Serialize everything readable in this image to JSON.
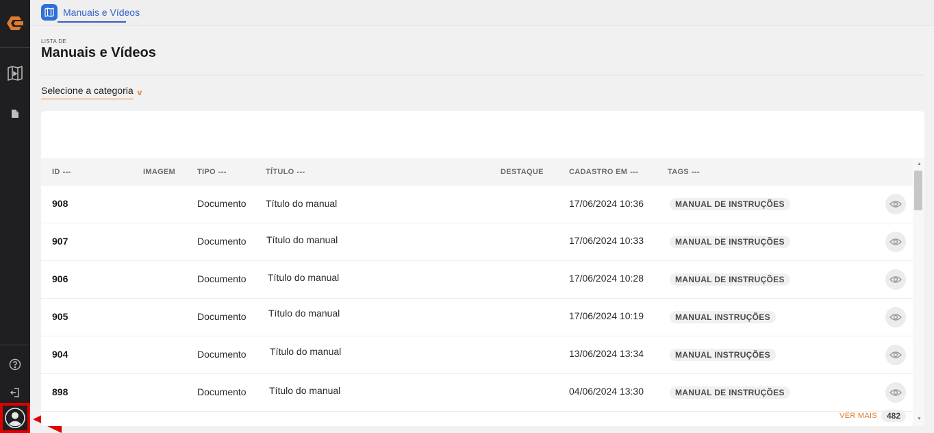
{
  "app": {
    "brand_color": "#e07a2e",
    "accent_color": "#2f5fc7",
    "highlight_color": "#e10000"
  },
  "sidebar": {
    "items": [
      {
        "name": "manuals-videos",
        "icon": "manual-book-icon"
      },
      {
        "name": "documents",
        "icon": "document-icon"
      },
      {
        "name": "help",
        "icon": "help-icon"
      },
      {
        "name": "logout",
        "icon": "logout-icon"
      },
      {
        "name": "profile",
        "icon": "user-avatar-icon"
      }
    ]
  },
  "topbar": {
    "tab_label": "Manuais e Vídeos"
  },
  "header": {
    "subtitle": "LISTA DE",
    "title": "Manuais e Vídeos"
  },
  "filter": {
    "category_label": "Selecione a categoria",
    "chevron": "v"
  },
  "table": {
    "columns": {
      "id": "ID",
      "imagem": "IMAGEM",
      "tipo": "TIPO",
      "titulo": "TÍTULO",
      "destaque": "DESTAQUE",
      "cadastro": "CADASTRO EM",
      "tags": "TAGS",
      "sort_glyph": "---"
    },
    "rows": [
      {
        "id": "908",
        "tipo": "Documento",
        "titulo": "Título do manual",
        "cadastro": "17/06/2024 10:36",
        "tag": "MANUAL DE INSTRUÇÕES"
      },
      {
        "id": "907",
        "tipo": "Documento",
        "titulo": "Título do manual",
        "cadastro": "17/06/2024 10:33",
        "tag": "MANUAL DE INSTRUÇÕES"
      },
      {
        "id": "906",
        "tipo": "Documento",
        "titulo": "Título do manual",
        "cadastro": "17/06/2024 10:28",
        "tag": "MANUAL DE INSTRUÇÕES"
      },
      {
        "id": "905",
        "tipo": "Documento",
        "titulo": "Título do manual",
        "cadastro": "17/06/2024 10:19",
        "tag": "MANUAL INSTRUÇÕES"
      },
      {
        "id": "904",
        "tipo": "Documento",
        "titulo": "Título do manual",
        "cadastro": "13/06/2024 13:34",
        "tag": "MANUAL INSTRUÇÕES"
      },
      {
        "id": "898",
        "tipo": "Documento",
        "titulo": "Título do manual",
        "cadastro": "04/06/2024 13:30",
        "tag": "MANUAL DE INSTRUÇÕES"
      }
    ]
  },
  "footer": {
    "more_label": "VER MAIS",
    "total": "482"
  }
}
